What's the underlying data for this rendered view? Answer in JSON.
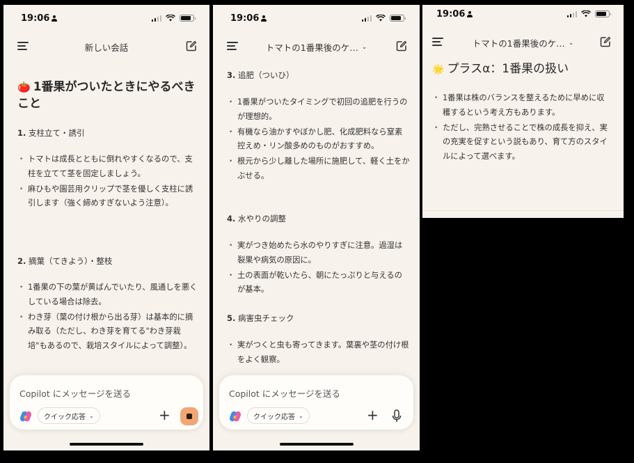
{
  "status": {
    "time": "19:06"
  },
  "phone1": {
    "nav_title": "新しい会話",
    "heading_emoji": "🍅",
    "heading": "1番果がついたときにやるべきこと",
    "sections": [
      {
        "num": "1.",
        "title": "支柱立て・誘引",
        "items": [
          "トマトは成長とともに倒れやすくなるので、支柱を立てて茎を固定しましょう。",
          "麻ひもや園芸用クリップで茎を優しく支柱に誘引します（強く締めすぎないよう注意）。"
        ]
      },
      {
        "num": "2.",
        "title": "摘葉（てきよう）・整枝",
        "items": [
          "1番果の下の葉が黄ばんでいたり、風通しを悪くしている場合は除去。",
          "わき芽（葉の付け根から出る芽）は基本的に摘み取る（ただし、わき芽を育てる\"わき芽栽培\"もあるので、栽培スタイルによって調整）。"
        ]
      }
    ],
    "composer": {
      "placeholder": "Copilot にメッセージを送る",
      "quick_label": "クイック応答"
    }
  },
  "phone2": {
    "nav_title": "トマトの1番果後のケ…",
    "sections": [
      {
        "num": "3.",
        "title": "追肥（ついひ）",
        "items": [
          "1番果がついたタイミングで初回の追肥を行うのが理想的。",
          "有機なら油かすやぼかし肥、化成肥料なら窒素控えめ・リン酸多めのものがおすすめ。",
          "根元から少し離した場所に施肥して、軽く土をかぶせる。"
        ]
      },
      {
        "num": "4.",
        "title": "水やりの調整",
        "items": [
          "実がつき始めたら水のやりすぎに注意。過湿は裂果や病気の原因に。",
          "土の表面が乾いたら、朝にたっぷりと与えるのが基本。"
        ]
      },
      {
        "num": "5.",
        "title": "病害虫チェック",
        "items": [
          "実がつくと虫も寄ってきます。葉裏や茎の付け根をよく観察。"
        ]
      }
    ],
    "composer": {
      "placeholder": "Copilot にメッセージを送る",
      "quick_label": "クイック応答"
    }
  },
  "phone3": {
    "nav_title": "トマトの1番果後のケ…",
    "heading_emoji": "🌟",
    "heading": "プラスα：1番果の扱い",
    "items": [
      "1番果は株のバランスを整えるために早めに収穫するという考え方もあります。",
      "ただし、完熟させることで株の成長を抑え、実の充実を促すという説もあり、育て方のスタイルによって選べます。"
    ]
  }
}
